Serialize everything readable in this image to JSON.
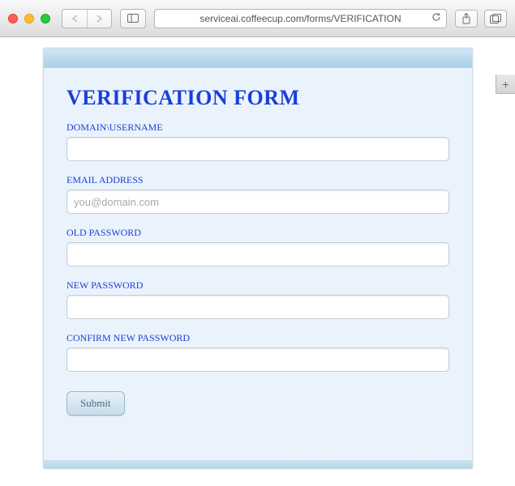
{
  "chrome": {
    "addr_text": "serviceai.coffeecup.com/forms/VERIFICATION",
    "new_tab_glyph": "+"
  },
  "form": {
    "title": "VERIFICATION FORM",
    "fields": {
      "domain_username": {
        "label": "DOMAIN\\USERNAME",
        "value": "",
        "placeholder": ""
      },
      "email": {
        "label": "EMAIL ADDRESS",
        "value": "",
        "placeholder": "you@domain.com"
      },
      "old_password": {
        "label": "OLD PASSWORD",
        "value": "",
        "placeholder": ""
      },
      "new_password": {
        "label": "NEW PASSWORD",
        "value": "",
        "placeholder": ""
      },
      "confirm_password": {
        "label": "CONFIRM NEW PASSWORD",
        "value": "",
        "placeholder": ""
      }
    },
    "submit_label": "Submit"
  }
}
